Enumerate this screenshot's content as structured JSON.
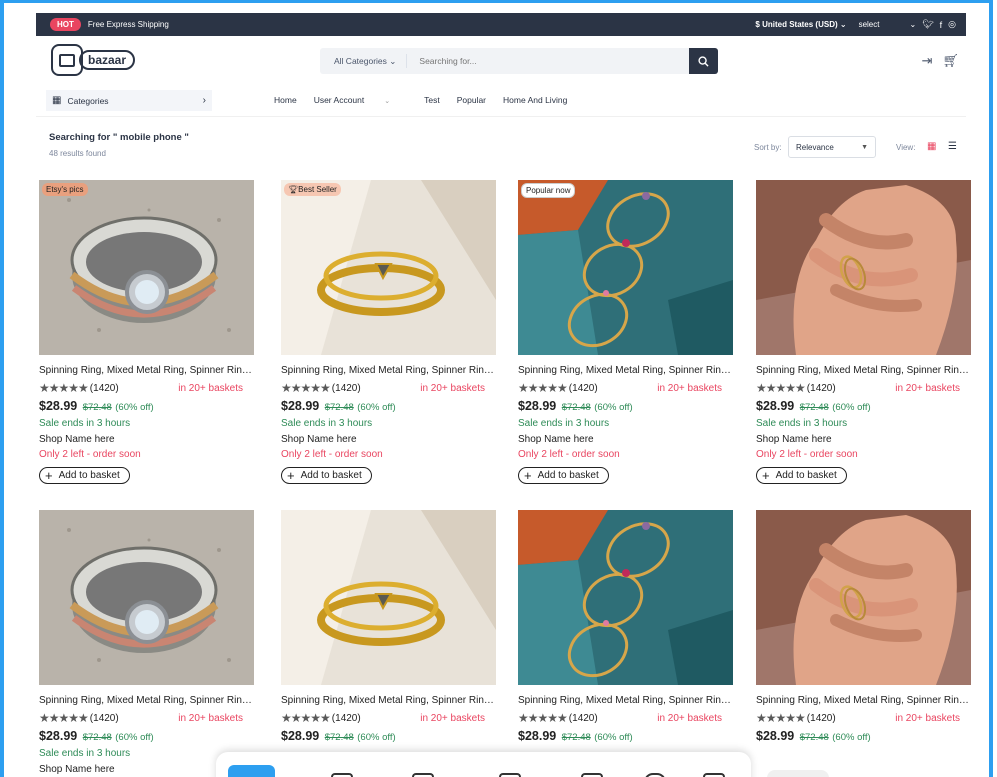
{
  "topbar": {
    "hot": "HOT",
    "shipping": "Free Express Shipping",
    "currency": "$ United States (USD)",
    "select": "select"
  },
  "header": {
    "logo": "bazaar",
    "search_category": "All Categories",
    "search_placeholder": "Searching for..."
  },
  "nav": {
    "categories": "Categories",
    "links": [
      "Home",
      "User Account",
      "Test",
      "Popular",
      "Home And Living"
    ]
  },
  "results": {
    "title": "Searching for \" mobile phone \"",
    "count": "48 results found",
    "sort_label": "Sort by:",
    "sort_value": "Relevance",
    "view_label": "View:"
  },
  "products": [
    {
      "badge": "Etsy's pics",
      "badge_type": "etsy",
      "title": "Spinning Ring, Mixed Metal Ring, Spinner Ring, Sterling Silver and Gold Ring, Meditat...",
      "rating": 5,
      "reviews": "(1420)",
      "baskets": "in 20+ baskets",
      "price": "$28.99",
      "old_price": "$72.48",
      "discount": "(60% off)",
      "sale": "Sale ends in 3 hours",
      "shop": "Shop Name here",
      "stock": "Only 2 left - order soon",
      "add": "Add to basket",
      "image": "spinner-ring"
    },
    {
      "badge": "Best Seller",
      "badge_type": "best",
      "title": "Spinning Ring, Mixed Metal Ring, Spinner Ring, Sterling Silver and Gold Ring, Meditat...",
      "rating": 5,
      "reviews": "(1420)",
      "baskets": "in 20+ baskets",
      "price": "$28.99",
      "old_price": "$72.48",
      "discount": "(60% off)",
      "sale": "Sale ends in 3 hours",
      "shop": "Shop Name here",
      "stock": "Only 2 left - order soon",
      "add": "Add to basket",
      "image": "gold-triangle-ring"
    },
    {
      "badge": "Popular now",
      "badge_type": "pop",
      "title": "Spinning Ring, Mixed Metal Ring, Spinner Ring, Sterling Silver and Gold Ring, Meditat...",
      "rating": 5,
      "reviews": "(1420)",
      "baskets": "in 20+ baskets",
      "price": "$28.99",
      "old_price": "$72.48",
      "discount": "(60% off)",
      "sale": "Sale ends in 3 hours",
      "shop": "Shop Name here",
      "stock": "Only 2 left - order soon",
      "add": "Add to basket",
      "image": "gemstone-rings"
    },
    {
      "badge": "",
      "badge_type": "",
      "title": "Spinning Ring, Mixed Metal Ring, Spinner Ring, Sterling Silver and Gold Ring, Meditat...",
      "rating": 5,
      "reviews": "(1420)",
      "baskets": "in 20+ baskets",
      "price": "$28.99",
      "old_price": "$72.48",
      "discount": "(60% off)",
      "sale": "Sale ends in 3 hours",
      "shop": "Shop Name here",
      "stock": "Only 2 left - order soon",
      "add": "Add to basket",
      "image": "hand-ring"
    },
    {
      "badge": "",
      "badge_type": "",
      "title": "Spinning Ring, Mixed Metal Ring, Spinner Ring, Sterling Silver and Gold Ring, Meditat...",
      "rating": 5,
      "reviews": "(1420)",
      "baskets": "in 20+ baskets",
      "price": "$28.99",
      "old_price": "$72.48",
      "discount": "(60% off)",
      "sale": "Sale ends in 3 hours",
      "shop": "Shop Name here",
      "stock": "",
      "add": "",
      "image": "spinner-ring"
    },
    {
      "badge": "",
      "badge_type": "",
      "title": "Spinning Ring, Mixed Metal Ring, Spinner Ring, Sterling Silver and Gold Ring, Meditat...",
      "rating": 5,
      "reviews": "(1420)",
      "baskets": "in 20+ baskets",
      "price": "$28.99",
      "old_price": "$72.48",
      "discount": "(60% off)",
      "sale": "",
      "shop": "",
      "stock": "",
      "add": "",
      "image": "gold-triangle-ring"
    },
    {
      "badge": "",
      "badge_type": "",
      "title": "Spinning Ring, Mixed Metal Ring, Spinner Ring, Sterling Silver and Gold Ring, Meditat...",
      "rating": 5,
      "reviews": "(1420)",
      "baskets": "in 20+ baskets",
      "price": "$28.99",
      "old_price": "$72.48",
      "discount": "(60% off)",
      "sale": "",
      "shop": "",
      "stock": "",
      "add": "",
      "image": "gemstone-rings"
    },
    {
      "badge": "",
      "badge_type": "",
      "title": "Spinning Ring, Mixed Metal Ring, Spinner Ring, Sterling Silver and Gold Ring, Meditat...",
      "rating": 5,
      "reviews": "(1420)",
      "baskets": "in 20+ baskets",
      "price": "$28.99",
      "old_price": "$72.48",
      "discount": "(60% off)",
      "sale": "",
      "shop": "",
      "stock": "",
      "add": "",
      "image": "hand-ring"
    }
  ],
  "colors": {
    "accent": "#e94560",
    "dark": "#2b3445",
    "green": "#2e8b57",
    "frame": "#2d9ff0"
  }
}
